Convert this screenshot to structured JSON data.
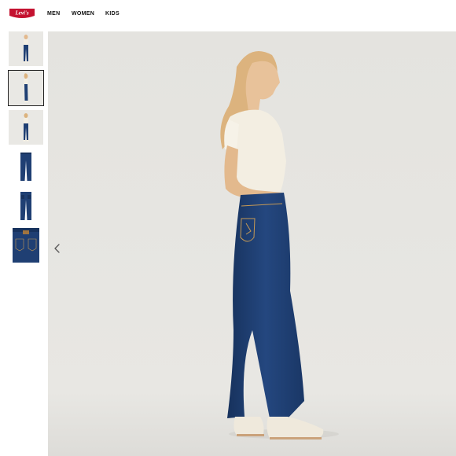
{
  "brand": {
    "logo_text": "Levi's",
    "logo_color": "#c41230"
  },
  "nav": {
    "items": [
      "MEN",
      "WOMEN",
      "KIDS"
    ]
  },
  "gallery": {
    "thumbnails": [
      {
        "label": "model front view",
        "selected": false
      },
      {
        "label": "model side view",
        "selected": true
      },
      {
        "label": "model back view",
        "selected": false
      },
      {
        "label": "jeans front flat",
        "selected": false
      },
      {
        "label": "jeans back flat",
        "selected": false
      },
      {
        "label": "jeans waistband detail",
        "selected": false
      }
    ],
    "main_image": "model wearing high-rise dark wash tapered jeans and white cropped top, side view",
    "prev_icon": "chevron-left-icon"
  },
  "colors": {
    "denim": "#1f3f73",
    "background": "#e6e5e1",
    "top": "#f3eee2"
  }
}
